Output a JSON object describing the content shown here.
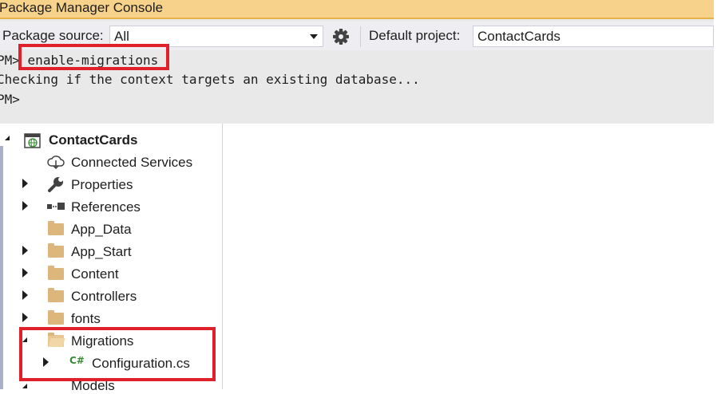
{
  "console_window": {
    "title": "Package Manager Console",
    "package_source_label": "Package source:",
    "package_source_value": "All",
    "default_project_label": "Default project:",
    "default_project_value": "ContactCards",
    "lines": [
      {
        "prompt": "PM>",
        "text": "enable-migrations"
      },
      {
        "prompt": "",
        "text": "Checking if the context targets an existing database..."
      },
      {
        "prompt": "PM>",
        "text": ""
      }
    ]
  },
  "solution_explorer": {
    "project": {
      "label": "ContactCards",
      "icon": "globe-project-icon"
    },
    "items": [
      {
        "label": "Connected Services",
        "icon": "cloud-services-icon",
        "expander": "none"
      },
      {
        "label": "Properties",
        "icon": "wrench-icon",
        "expander": "collapsed"
      },
      {
        "label": "References",
        "icon": "references-icon",
        "expander": "collapsed"
      },
      {
        "label": "App_Data",
        "icon": "folder-icon",
        "expander": "none"
      },
      {
        "label": "App_Start",
        "icon": "folder-icon",
        "expander": "collapsed"
      },
      {
        "label": "Content",
        "icon": "folder-icon",
        "expander": "collapsed"
      },
      {
        "label": "Controllers",
        "icon": "folder-icon",
        "expander": "collapsed"
      },
      {
        "label": "fonts",
        "icon": "folder-icon",
        "expander": "collapsed"
      },
      {
        "label": "Migrations",
        "icon": "open-folder-icon",
        "expander": "expanded"
      },
      {
        "label": "Configuration.cs",
        "icon": "csharp-file-icon",
        "expander": "collapsed"
      },
      {
        "label": "Models",
        "icon": "folder-icon",
        "expander": "collapsed"
      }
    ]
  },
  "colors": {
    "title_bar": "#f6d28a",
    "console_bg": "#e9e9e9",
    "highlight_box": "#e0202a",
    "folder": "#dcb67a",
    "csharp_icon": "#388a34"
  }
}
